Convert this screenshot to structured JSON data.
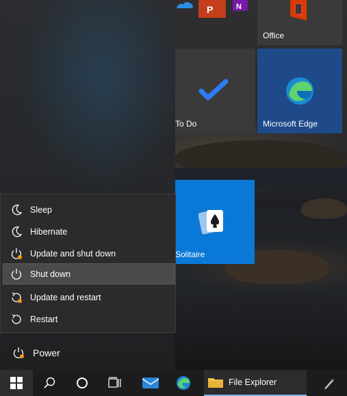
{
  "tiles": [
    {
      "id": "office",
      "label": "Office"
    },
    {
      "id": "todo",
      "label": "To Do"
    },
    {
      "id": "edge",
      "label": "Microsoft Edge"
    },
    {
      "id": "solitaire",
      "label": "Solitaire"
    }
  ],
  "power_menu": {
    "items": [
      {
        "label": "Sleep",
        "icon": "moon-icon"
      },
      {
        "label": "Hibernate",
        "icon": "moon-icon"
      },
      {
        "label": "Update and shut down",
        "icon": "power-update-icon"
      },
      {
        "label": "Shut down",
        "icon": "power-icon",
        "selected": true
      },
      {
        "label": "Update and restart",
        "icon": "restart-update-icon"
      },
      {
        "label": "Restart",
        "icon": "restart-icon"
      }
    ]
  },
  "power_button": {
    "label": "Power"
  },
  "taskbar": {
    "file_explorer_label": "File Explorer"
  },
  "colors": {
    "update_dot": "#f7941d",
    "tile_blue": "#0a78d7",
    "edge_tile": "#1f4a8a"
  }
}
